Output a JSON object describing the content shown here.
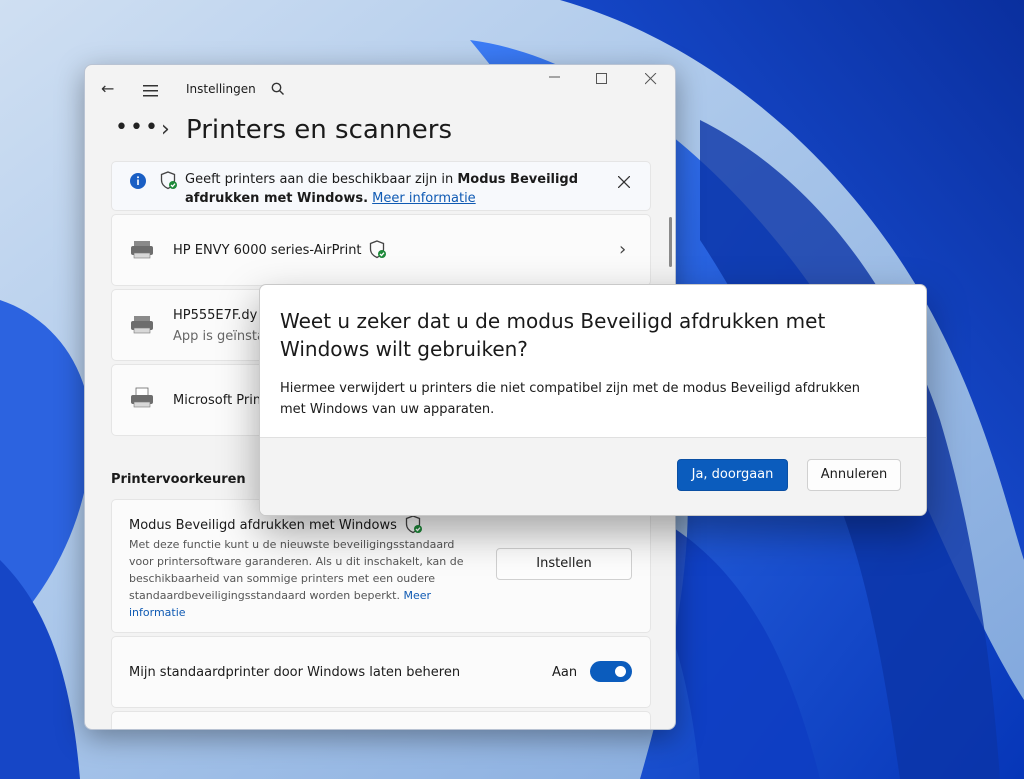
{
  "window": {
    "title": "Instellingen",
    "breadcrumb_dots": "•••",
    "breadcrumb_chevron": "›",
    "page_title": "Printers en scanners"
  },
  "info_bar": {
    "text_regular": "Geeft printers aan die beschikbaar zijn in ",
    "text_bold_1": "Modus Beveiligd",
    "text_bold_2": "afdrukken met Windows.",
    "link": "Meer informatie"
  },
  "printers": [
    {
      "name": "HP ENVY 6000 series-AirPrint",
      "status": ""
    },
    {
      "name": "HP555E7F.dy",
      "status": "App is geïnsta"
    },
    {
      "name": "Microsoft Prin",
      "status": ""
    }
  ],
  "preferences": {
    "header": "Printervoorkeuren",
    "secure_mode_title": "Modus Beveiligd afdrukken met Windows",
    "secure_mode_desc_1": "Met deze functie kunt u de nieuwste beveiligingsstandaard",
    "secure_mode_desc_2": "voor printersoftware garanderen. Als u dit inschakelt, kan de",
    "secure_mode_desc_3": "beschikbaarheid van sommige printers met een oudere",
    "secure_mode_desc_4": "standaardbeveiligingsstandaard worden beperkt. ",
    "secure_mode_link_1": "Meer",
    "secure_mode_link_2": "informatie",
    "setup_button": "Instellen",
    "default_printer_label": "Mijn standaardprinter door Windows laten beheren",
    "default_printer_state": "Aan"
  },
  "dialog": {
    "title": "Weet u zeker dat u de modus Beveiligd afdrukken met Windows wilt gebruiken?",
    "body": "Hiermee verwijdert u printers die niet compatibel zijn met de modus Beveiligd afdrukken met Windows van uw apparaten.",
    "confirm_button": "Ja, doorgaan",
    "cancel_button": "Annuleren"
  },
  "colors": {
    "accent": "#0b5cbd",
    "shield_check": "#1e8a3a"
  }
}
